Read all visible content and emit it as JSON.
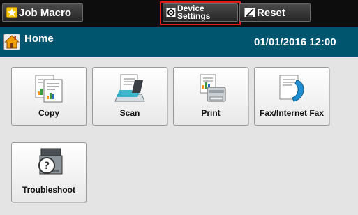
{
  "topbar": {
    "job_macro_label": "Job Macro",
    "device_settings_line1": "Device",
    "device_settings_line2": "Settings",
    "reset_label": "Reset",
    "highlight_color": "#e21b1b"
  },
  "titlebar": {
    "title": "Home",
    "datetime": "01/01/2016 12:00",
    "background_color": "#00556e"
  },
  "tiles": [
    {
      "label": "Copy",
      "icon": "copy-icon"
    },
    {
      "label": "Scan",
      "icon": "scan-icon"
    },
    {
      "label": "Print",
      "icon": "print-icon"
    },
    {
      "label": "Fax/Internet Fax",
      "icon": "fax-icon"
    },
    {
      "label": "Troubleshoot",
      "icon": "troubleshoot-icon"
    }
  ]
}
